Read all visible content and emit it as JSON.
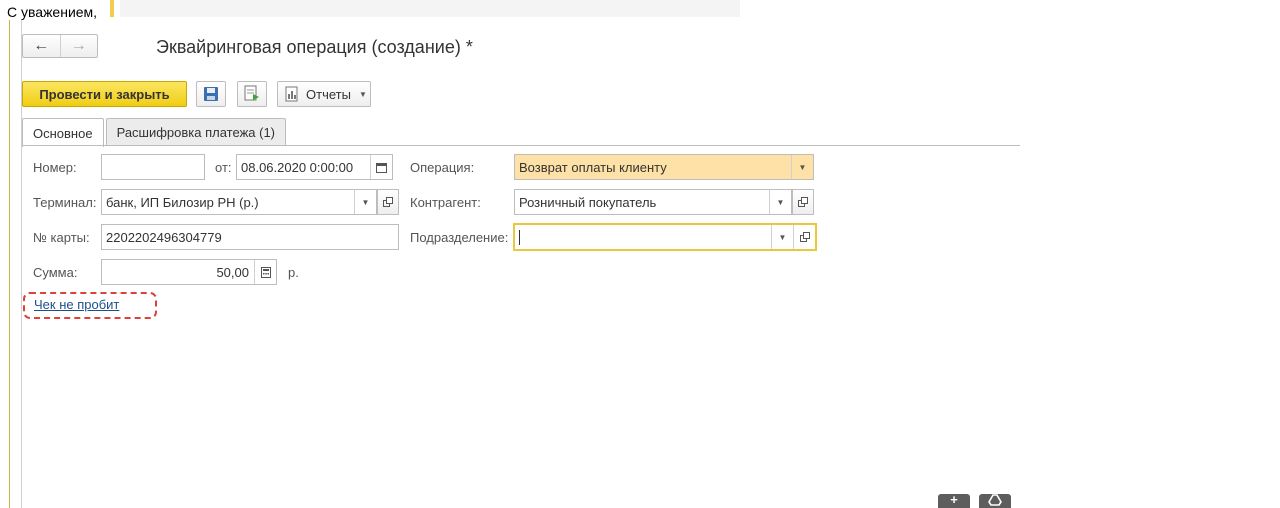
{
  "greeting": "С уважением,",
  "window": {
    "title": "Эквайринговая операция (создание) *",
    "nav": {
      "back_glyph": "←",
      "forward_glyph": "→"
    }
  },
  "toolbar": {
    "post_close_label": "Провести и закрыть",
    "save_icon": "floppy-disk-icon",
    "post_icon": "post-document-icon",
    "reports_label": "Отчеты"
  },
  "tabs": [
    {
      "label": "Основное",
      "active": true
    },
    {
      "label": "Расшифровка платежа (1)",
      "active": false
    }
  ],
  "form": {
    "number": {
      "label": "Номер:",
      "value": ""
    },
    "date": {
      "label": "от:",
      "value": "08.06.2020  0:00:00"
    },
    "operation": {
      "label": "Операция:",
      "value": "Возврат оплаты клиенту"
    },
    "terminal": {
      "label": "Терминал:",
      "value": "банк, ИП Билозир РН (р.)"
    },
    "counterparty": {
      "label": "Контрагент:",
      "value": "Розничный покупатель"
    },
    "card": {
      "label": "№ карты:",
      "value": "2202202496304779"
    },
    "department": {
      "label": "Подразделение:",
      "value": ""
    },
    "amount": {
      "label": "Сумма:",
      "value": "50,00",
      "currency": "р."
    }
  },
  "receipt_link": "Чек не пробит",
  "colors": {
    "primary_button": "#f0cd14",
    "highlight_field": "#fde1a6",
    "annotation": "#e0403a"
  }
}
